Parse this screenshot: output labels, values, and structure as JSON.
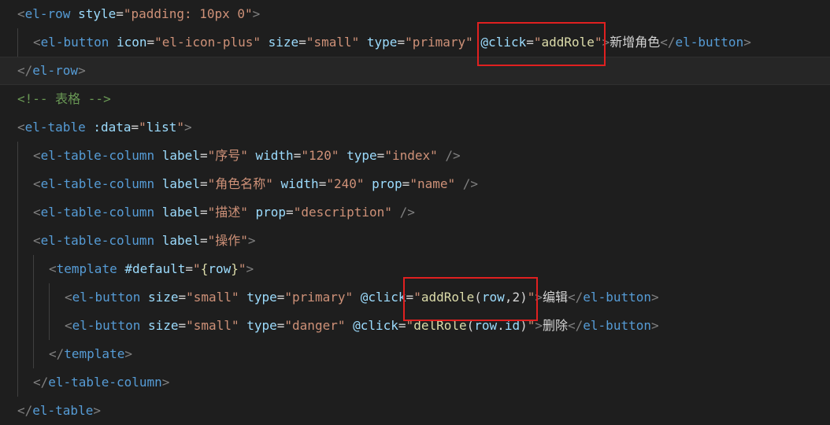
{
  "lines": [
    {
      "indent": 0,
      "tokens": [
        [
          "punct",
          "<"
        ],
        [
          "tag",
          "el-row"
        ],
        [
          "tk",
          " "
        ],
        [
          "attr",
          "style"
        ],
        [
          "tk",
          "="
        ],
        [
          "str",
          "\"padding: 10px 0\""
        ],
        [
          "punct",
          ">"
        ]
      ]
    },
    {
      "indent": 1,
      "tokens": [
        [
          "punct",
          "<"
        ],
        [
          "tag",
          "el-button"
        ],
        [
          "tk",
          " "
        ],
        [
          "attr",
          "icon"
        ],
        [
          "tk",
          "="
        ],
        [
          "str",
          "\"el-icon-plus\""
        ],
        [
          "tk",
          " "
        ],
        [
          "attr",
          "size"
        ],
        [
          "tk",
          "="
        ],
        [
          "str",
          "\"small\""
        ],
        [
          "tk",
          " "
        ],
        [
          "attr",
          "type"
        ],
        [
          "tk",
          "="
        ],
        [
          "str",
          "\"primary\""
        ],
        [
          "tk",
          " "
        ],
        [
          "attr",
          "@click"
        ],
        [
          "tk",
          "="
        ],
        [
          "str",
          "\""
        ],
        [
          "yellow",
          "addRole"
        ],
        [
          "str",
          "\""
        ],
        [
          "punct",
          ">"
        ],
        [
          "text",
          "新增角色"
        ],
        [
          "punct",
          "</"
        ],
        [
          "tag",
          "el-button"
        ],
        [
          "punct",
          ">"
        ]
      ]
    },
    {
      "indent": 0,
      "current": true,
      "tokens": [
        [
          "punct",
          "</"
        ],
        [
          "tag",
          "el-row"
        ],
        [
          "punct",
          ">"
        ]
      ]
    },
    {
      "indent": 0,
      "tokens": [
        [
          "comment",
          "<!-- 表格 -->"
        ]
      ]
    },
    {
      "indent": 0,
      "tokens": [
        [
          "punct",
          "<"
        ],
        [
          "tag",
          "el-table"
        ],
        [
          "tk",
          " "
        ],
        [
          "attr",
          ":data"
        ],
        [
          "tk",
          "="
        ],
        [
          "str",
          "\""
        ],
        [
          "attr",
          "list"
        ],
        [
          "str",
          "\""
        ],
        [
          "punct",
          ">"
        ]
      ]
    },
    {
      "indent": 1,
      "tokens": [
        [
          "punct",
          "<"
        ],
        [
          "tag",
          "el-table-column"
        ],
        [
          "tk",
          " "
        ],
        [
          "attr",
          "label"
        ],
        [
          "tk",
          "="
        ],
        [
          "str",
          "\"序号\""
        ],
        [
          "tk",
          " "
        ],
        [
          "attr",
          "width"
        ],
        [
          "tk",
          "="
        ],
        [
          "str",
          "\"120\""
        ],
        [
          "tk",
          " "
        ],
        [
          "attr",
          "type"
        ],
        [
          "tk",
          "="
        ],
        [
          "str",
          "\"index\""
        ],
        [
          "tk",
          " "
        ],
        [
          "punct",
          "/>"
        ]
      ]
    },
    {
      "indent": 1,
      "tokens": [
        [
          "punct",
          "<"
        ],
        [
          "tag",
          "el-table-column"
        ],
        [
          "tk",
          " "
        ],
        [
          "attr",
          "label"
        ],
        [
          "tk",
          "="
        ],
        [
          "str",
          "\"角色名称\""
        ],
        [
          "tk",
          " "
        ],
        [
          "attr",
          "width"
        ],
        [
          "tk",
          "="
        ],
        [
          "str",
          "\"240\""
        ],
        [
          "tk",
          " "
        ],
        [
          "attr",
          "prop"
        ],
        [
          "tk",
          "="
        ],
        [
          "str",
          "\"name\""
        ],
        [
          "tk",
          " "
        ],
        [
          "punct",
          "/>"
        ]
      ]
    },
    {
      "indent": 1,
      "tokens": [
        [
          "punct",
          "<"
        ],
        [
          "tag",
          "el-table-column"
        ],
        [
          "tk",
          " "
        ],
        [
          "attr",
          "label"
        ],
        [
          "tk",
          "="
        ],
        [
          "str",
          "\"描述\""
        ],
        [
          "tk",
          " "
        ],
        [
          "attr",
          "prop"
        ],
        [
          "tk",
          "="
        ],
        [
          "str",
          "\"description\""
        ],
        [
          "tk",
          " "
        ],
        [
          "punct",
          "/>"
        ]
      ]
    },
    {
      "indent": 1,
      "tokens": [
        [
          "punct",
          "<"
        ],
        [
          "tag",
          "el-table-column"
        ],
        [
          "tk",
          " "
        ],
        [
          "attr",
          "label"
        ],
        [
          "tk",
          "="
        ],
        [
          "str",
          "\"操作\""
        ],
        [
          "punct",
          ">"
        ]
      ]
    },
    {
      "indent": 2,
      "tokens": [
        [
          "punct",
          "<"
        ],
        [
          "tag",
          "template"
        ],
        [
          "tk",
          " "
        ],
        [
          "attr",
          "#default"
        ],
        [
          "tk",
          "="
        ],
        [
          "str",
          "\""
        ],
        [
          "yellow",
          "{"
        ],
        [
          "attr",
          "row"
        ],
        [
          "yellow",
          "}"
        ],
        [
          "str",
          "\""
        ],
        [
          "punct",
          ">"
        ]
      ]
    },
    {
      "indent": 3,
      "tokens": [
        [
          "punct",
          "<"
        ],
        [
          "tag",
          "el-button"
        ],
        [
          "tk",
          " "
        ],
        [
          "attr",
          "size"
        ],
        [
          "tk",
          "="
        ],
        [
          "str",
          "\"small\""
        ],
        [
          "tk",
          " "
        ],
        [
          "attr",
          "type"
        ],
        [
          "tk",
          "="
        ],
        [
          "str",
          "\"primary\""
        ],
        [
          "tk",
          " "
        ],
        [
          "attr",
          "@click"
        ],
        [
          "tk",
          "="
        ],
        [
          "str",
          "\""
        ],
        [
          "yellow",
          "addRole"
        ],
        [
          "tk",
          "("
        ],
        [
          "attr",
          "row"
        ],
        [
          "tk",
          ","
        ],
        [
          "tk",
          "2"
        ],
        [
          "tk",
          ")"
        ],
        [
          "str",
          "\""
        ],
        [
          "punct",
          ">"
        ],
        [
          "text",
          "编辑"
        ],
        [
          "punct",
          "</"
        ],
        [
          "tag",
          "el-button"
        ],
        [
          "punct",
          ">"
        ]
      ]
    },
    {
      "indent": 3,
      "tokens": [
        [
          "punct",
          "<"
        ],
        [
          "tag",
          "el-button"
        ],
        [
          "tk",
          " "
        ],
        [
          "attr",
          "size"
        ],
        [
          "tk",
          "="
        ],
        [
          "str",
          "\"small\""
        ],
        [
          "tk",
          " "
        ],
        [
          "attr",
          "type"
        ],
        [
          "tk",
          "="
        ],
        [
          "str",
          "\"danger\""
        ],
        [
          "tk",
          " "
        ],
        [
          "attr",
          "@click"
        ],
        [
          "tk",
          "="
        ],
        [
          "str",
          "\""
        ],
        [
          "yellow",
          "delRole"
        ],
        [
          "tk",
          "("
        ],
        [
          "attr",
          "row"
        ],
        [
          "tk",
          "."
        ],
        [
          "attr",
          "id"
        ],
        [
          "tk",
          ")"
        ],
        [
          "str",
          "\""
        ],
        [
          "punct",
          ">"
        ],
        [
          "text",
          "删除"
        ],
        [
          "punct",
          "</"
        ],
        [
          "tag",
          "el-button"
        ],
        [
          "punct",
          ">"
        ]
      ]
    },
    {
      "indent": 2,
      "tokens": [
        [
          "punct",
          "</"
        ],
        [
          "tag",
          "template"
        ],
        [
          "punct",
          ">"
        ]
      ]
    },
    {
      "indent": 1,
      "tokens": [
        [
          "punct",
          "</"
        ],
        [
          "tag",
          "el-table-column"
        ],
        [
          "punct",
          ">"
        ]
      ]
    },
    {
      "indent": 0,
      "tokens": [
        [
          "punct",
          "</"
        ],
        [
          "tag",
          "el-table"
        ],
        [
          "punct",
          ">"
        ]
      ]
    }
  ],
  "highlights": [
    {
      "line": 1,
      "label": "@click=\"addRole\""
    },
    {
      "line": 10,
      "label": "\"addRole(row,2)\""
    }
  ]
}
